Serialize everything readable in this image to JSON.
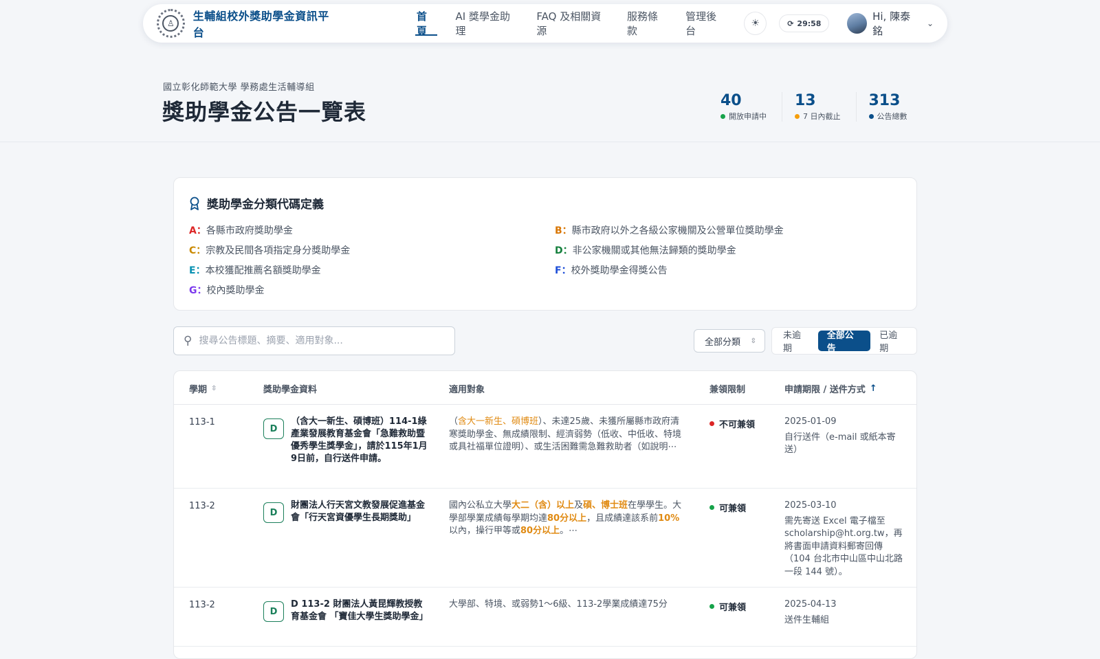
{
  "nav": {
    "brand": "生輔組校外獎助學金資訊平台",
    "links": [
      "首頁",
      "AI 獎學金助理",
      "FAQ 及相關資源",
      "服務條款",
      "管理後台"
    ],
    "timer": "29:58",
    "user": "Hi, 陳泰銘"
  },
  "header": {
    "org": "國立彰化師範大學 學務處生活輔導組",
    "title": "獎助學金公告一覽表",
    "stats": [
      {
        "value": "40",
        "label": "開放申請中",
        "color": "#16a34a"
      },
      {
        "value": "13",
        "label": "7 日內截止",
        "color": "#f59e0b"
      },
      {
        "value": "313",
        "label": "公告總數",
        "color": "#0b4f8a"
      }
    ]
  },
  "definitions": {
    "title": "獎助學金分類代碼定義",
    "items": [
      {
        "code": "A：",
        "text": "各縣市政府獎助學金",
        "color": "#dc2626"
      },
      {
        "code": "B：",
        "text": "縣市政府以外之各級公家機關及公營單位獎助學金",
        "color": "#d97706"
      },
      {
        "code": "C：",
        "text": "宗教及民間各項指定身分獎助學金",
        "color": "#ca8a04"
      },
      {
        "code": "D：",
        "text": "非公家機關或其他無法歸類的獎助學金",
        "color": "#15803d"
      },
      {
        "code": "E：",
        "text": "本校獲配推薦名額獎助學金",
        "color": "#0891b2"
      },
      {
        "code": "F：",
        "text": "校外獎助學金得獎公告",
        "color": "#1d4ed8"
      },
      {
        "code": "G：",
        "text": "校內獎助學金",
        "color": "#7c3aed"
      }
    ]
  },
  "filters": {
    "search_placeholder": "搜尋公告標題、摘要、適用對象...",
    "category": "全部分類",
    "segments": [
      "未逾期",
      "全部公告",
      "已逾期"
    ],
    "active_segment": "全部公告"
  },
  "table": {
    "headers": [
      "學期",
      "獎助學金資料",
      "適用對象",
      "兼領限制",
      "申請期限 / 送件方式"
    ],
    "rows": [
      {
        "term": "113-1",
        "code": "D",
        "title": "（含大一新生、碩博班）114-1綠產業發展教育基金會「急難救助暨優秀學生獎學金」，請於115年1月9日前，自行送件申請。",
        "target_parts": [
          {
            "t": "（",
            "c": ""
          },
          {
            "t": "含大一新生、碩博班",
            "c": "hl"
          },
          {
            "t": "）、未達25歲、未獲所屬縣市政府清寒獎助學金、無成績限制、經濟弱勢（低收、中低收、特境或具社福單位證明）、或生活困難需急難救助者（如說明⋯",
            "c": ""
          }
        ],
        "limit": "不可兼領",
        "limit_color": "#dc2626",
        "date": "2025-01-09",
        "method": "自行送件（e-mail 或紙本寄送）"
      },
      {
        "term": "113-2",
        "code": "D",
        "title": "財團法人行天宮文教發展促進基金會「行天宮資優學生長期獎助」",
        "target_parts": [
          {
            "t": "國內公私立大學",
            "c": ""
          },
          {
            "t": "大二（含）以上",
            "c": "hl-b"
          },
          {
            "t": "及",
            "c": ""
          },
          {
            "t": "碩、博士班",
            "c": "hl-b"
          },
          {
            "t": "在學學生。大學部學業成績每學期均達",
            "c": ""
          },
          {
            "t": "80分以上",
            "c": "hl-b"
          },
          {
            "t": "，且成績達該系前",
            "c": ""
          },
          {
            "t": "10%",
            "c": "hl-b"
          },
          {
            "t": "以內，操行甲等或",
            "c": ""
          },
          {
            "t": "80分以上",
            "c": "hl-b"
          },
          {
            "t": "。⋯",
            "c": ""
          }
        ],
        "limit": "可兼領",
        "limit_color": "#16a34a",
        "date": "2025-03-10",
        "method": "需先寄送 Excel 電子檔至 scholarship@ht.org.tw，再將書面申請資料郵寄回傳（104 台北市中山區中山北路一段 144 號）。"
      },
      {
        "term": "113-2",
        "code": "D",
        "title": "D 113-2 財團法人黃昆輝教授教育基金會 「寶佳大學生獎助學金」",
        "target_parts": [
          {
            "t": "大學部、特境、或弱勢1～6級、113-2學業成績達75分",
            "c": ""
          }
        ],
        "limit": "可兼領",
        "limit_color": "#16a34a",
        "date": "2025-04-13",
        "method": "送件生輔組"
      }
    ]
  }
}
